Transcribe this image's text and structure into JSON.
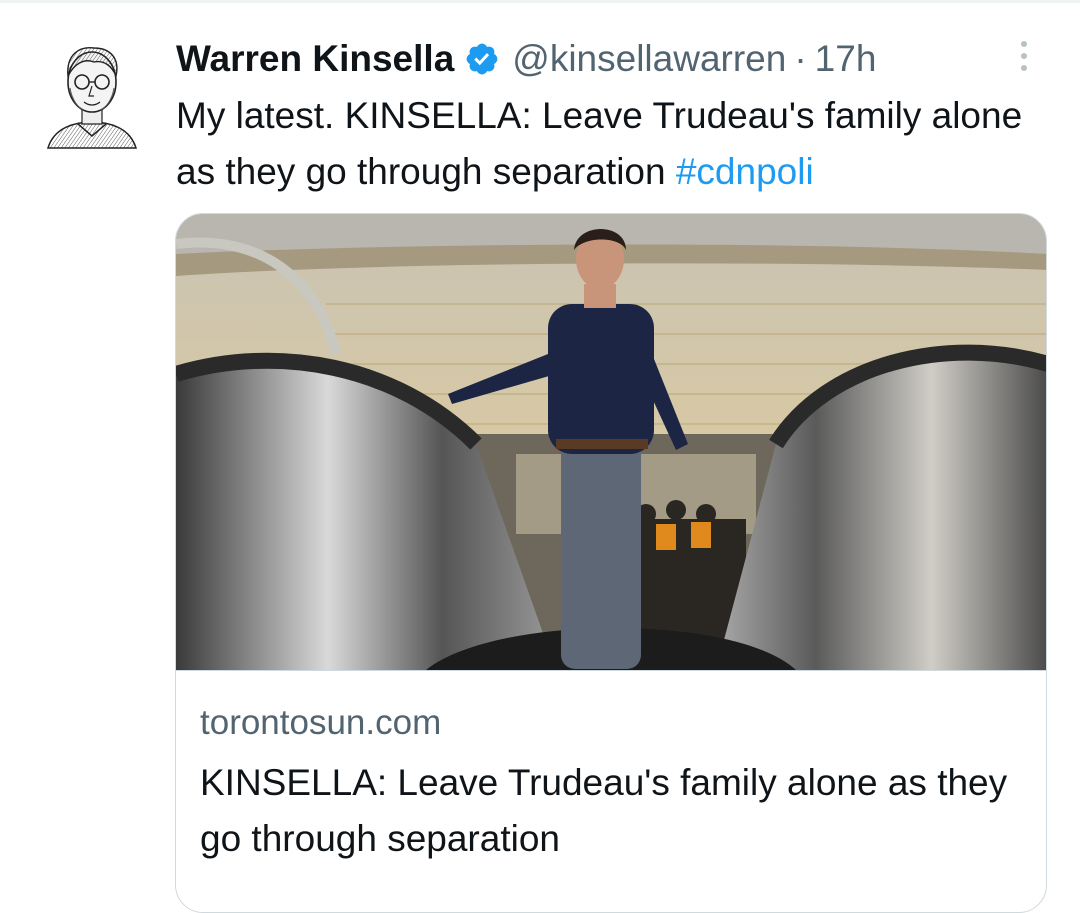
{
  "tweet": {
    "author_name": "Warren Kinsella",
    "handle": "@kinsellawarren",
    "separator": "·",
    "time": "17h",
    "text": "My latest. KINSELLA: Leave Trudeau's family alone as they go through separation ",
    "hashtag": "#cdnpoli"
  },
  "card": {
    "domain": "torontosun.com",
    "title": "KINSELLA: Leave Trudeau's family alone as they go through separation"
  },
  "colors": {
    "accent": "#1d9bf0",
    "secondary_text": "#536471",
    "border": "#cfd9de"
  },
  "icons": {
    "verified": "verified-badge-icon",
    "more": "more-options-icon"
  }
}
